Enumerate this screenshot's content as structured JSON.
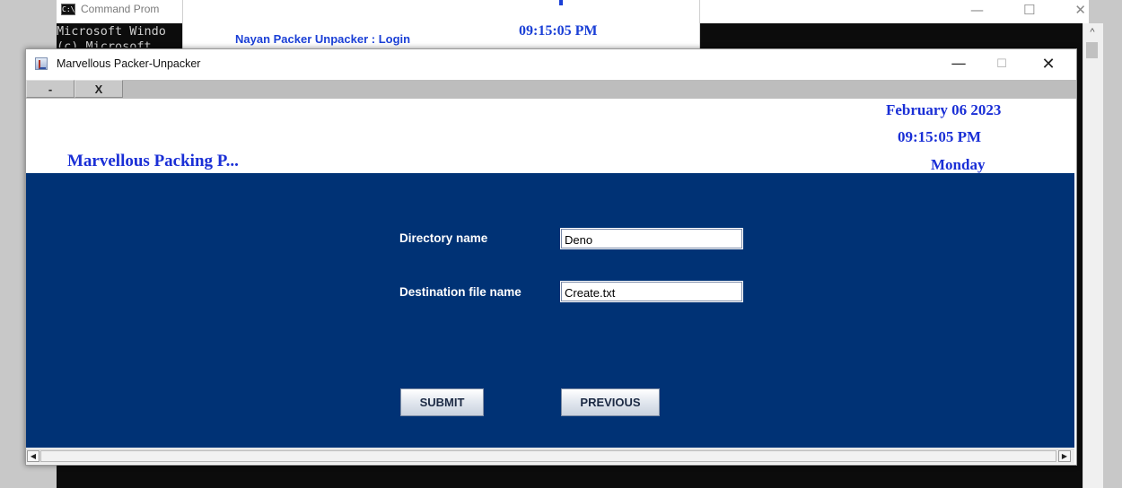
{
  "background": {
    "cmd": {
      "title": "Command Prom",
      "icon_glyph": "C:\\",
      "line1": "Microsoft Windo",
      "line2": "(c) Microsoft",
      "min_glyph": "—",
      "max_glyph": "☐",
      "close_glyph": "✕",
      "scroll_up_glyph": "^"
    },
    "login": {
      "title": "Nayan Packer Unpacker : Login",
      "time": "09:15:05 PM"
    }
  },
  "window": {
    "title": "Marvellous Packer-Unpacker",
    "min_glyph": "—",
    "max_glyph": "☐",
    "close_glyph": "✕"
  },
  "menubar": {
    "minimize_label": "-",
    "close_label": "X"
  },
  "header": {
    "heading": "Marvellous Packing P...",
    "date": "February 06 2023",
    "time": "09:15:05 PM",
    "day": "Monday"
  },
  "form": {
    "directory_label": "Directory name",
    "directory_value": "Deno",
    "destination_label": "Destination file name",
    "destination_value": "Create.txt",
    "submit_label": "SUBMIT",
    "previous_label": "PREVIOUS"
  },
  "scrollbar": {
    "left_glyph": "◀",
    "right_glyph": "▶"
  },
  "colors": {
    "content_bg": "#003275",
    "accent_text": "#1a2fd6",
    "menubar_bg": "#bdbdbd"
  }
}
